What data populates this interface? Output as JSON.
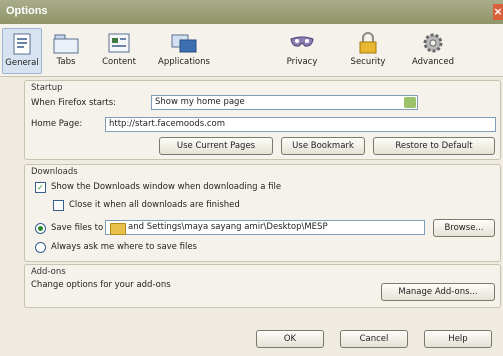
{
  "window": {
    "title": "Options"
  },
  "toolbar": {
    "tabs": [
      {
        "label": "General",
        "icon": "general-icon",
        "selected": true
      },
      {
        "label": "Tabs",
        "icon": "tabs-icon",
        "selected": false
      },
      {
        "label": "Content",
        "icon": "content-icon",
        "selected": false
      },
      {
        "label": "Applications",
        "icon": "applications-icon",
        "selected": false
      },
      {
        "label": "Privacy",
        "icon": "privacy-icon",
        "selected": false
      },
      {
        "label": "Security",
        "icon": "security-icon",
        "selected": false
      },
      {
        "label": "Advanced",
        "icon": "advanced-icon",
        "selected": false
      }
    ]
  },
  "startup": {
    "heading": "Startup",
    "when_label": "When Firefox starts:",
    "when_value": "Show my home page",
    "home_label": "Home Page:",
    "home_value": "http://start.facemoods.com",
    "use_current": "Use Current Pages",
    "use_bookmark": "Use Bookmark",
    "restore_default": "Restore to Default"
  },
  "downloads": {
    "heading": "Downloads",
    "show_window": "Show the Downloads window when downloading a file",
    "show_window_checked": true,
    "close_it": "Close it when all downloads are finished",
    "close_it_checked": false,
    "save_files": "Save files to",
    "save_path": "and Settings\\maya sayang amir\\Desktop\\MESP",
    "browse": "Browse...",
    "always_ask": "Always ask me where to save files",
    "selected_option": "save_files"
  },
  "addons": {
    "heading": "Add-ons",
    "description": "Change options for your add-ons",
    "manage": "Manage Add-ons..."
  },
  "footer": {
    "ok": "OK",
    "cancel": "Cancel",
    "help": "Help"
  },
  "colors": {
    "titlebar": "#9a9e76",
    "selected_tab": "#d7e3f1",
    "check": "#2a8a2a"
  }
}
